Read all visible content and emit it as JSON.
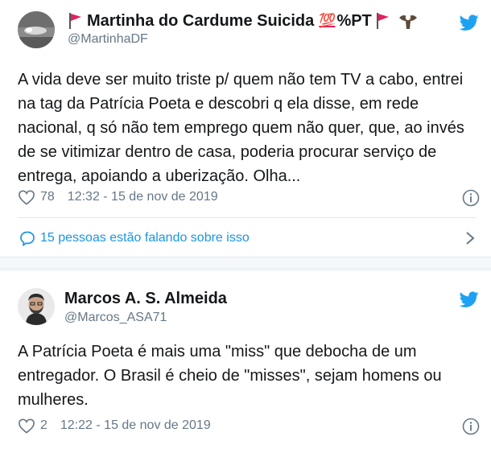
{
  "tweets": [
    {
      "author": {
        "name": "Martinha do Cardume Suicida",
        "emoji_hundred": "💯",
        "suffix": "%PT",
        "handle": "@MartinhaDF"
      },
      "text_lines": [
        "A vida deve ser muito triste p/ quem não tem TV a cabo, entrei",
        "na tag da Patrícia Poeta e descobri q ela disse, em rede",
        "nacional, q só não tem emprego quem não quer, que, ao invés",
        "de se vitimizar dentro de casa, poderia procurar serviço de",
        "entrega, apoiando a uberização. Olha..."
      ],
      "likes": "78",
      "timestamp": "12:32 - 15 de nov de 2019",
      "conversation": "15 pessoas estão falando sobre isso"
    },
    {
      "author": {
        "name": "Marcos A. S. Almeida",
        "handle": "@Marcos_ASA71"
      },
      "text_lines": [
        "A Patrícia Poeta é mais uma \"miss\" que debocha de um",
        "entregador. O Brasil é cheio de \"misses\", sejam homens ou",
        "mulheres."
      ],
      "likes": "2",
      "timestamp": "12:22 - 15 de nov de 2019"
    }
  ],
  "colors": {
    "twitter_blue": "#1da1f2",
    "link_blue": "#1b95e0",
    "muted": "#657786",
    "text": "#14171a",
    "flag_red": "#e0245e"
  }
}
